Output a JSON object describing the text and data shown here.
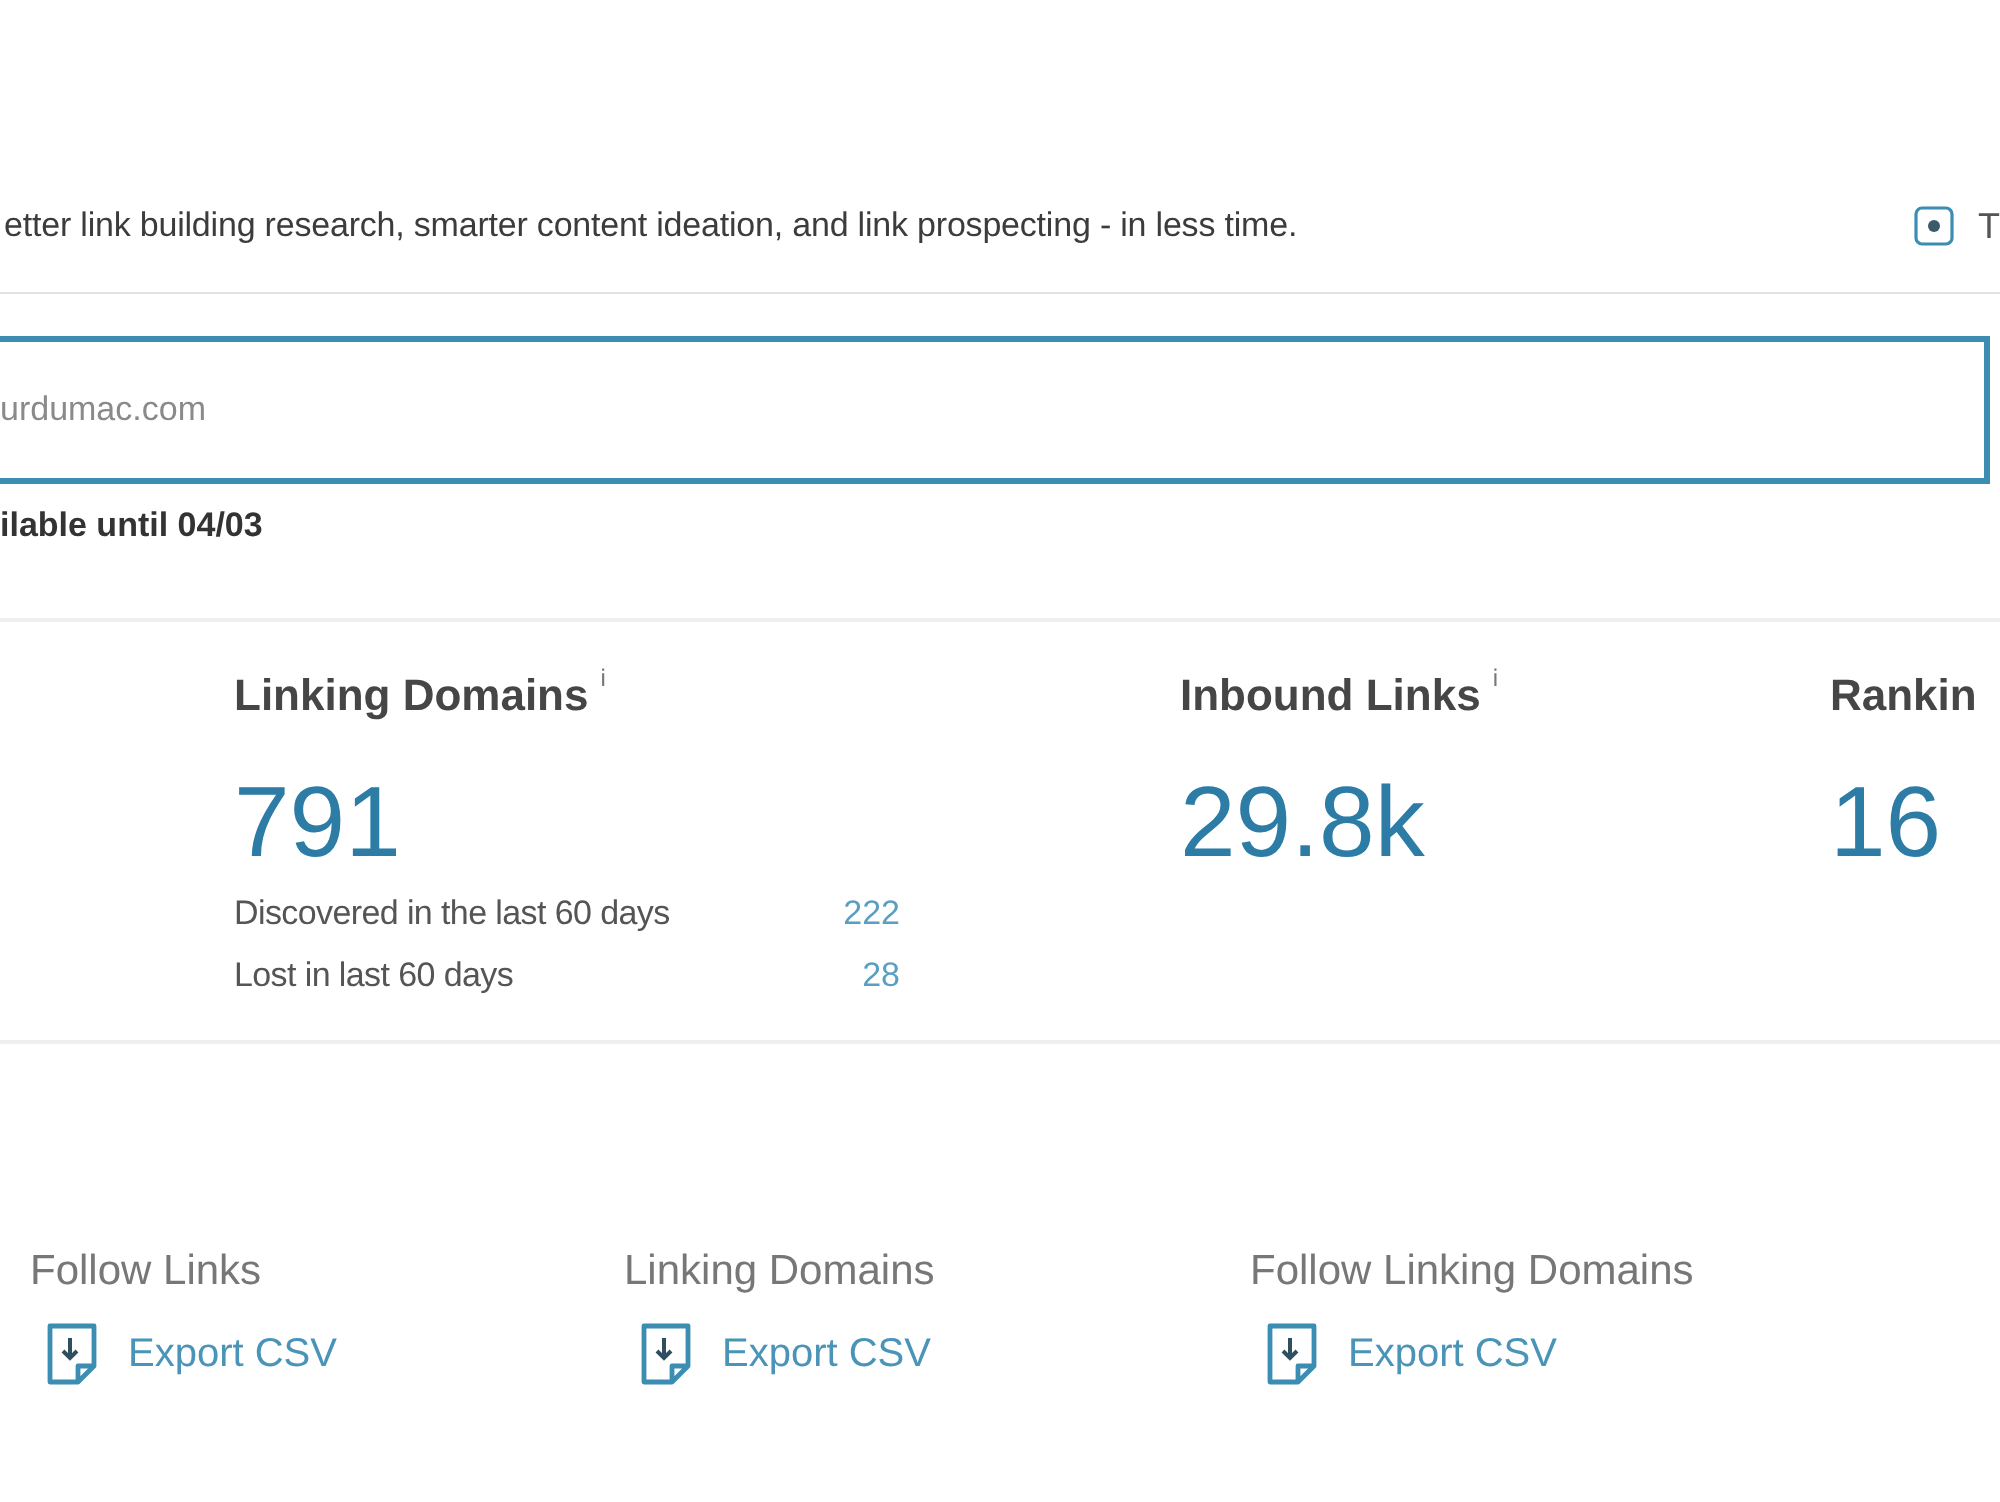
{
  "header": {
    "tagline": "etter link building research, smarter content ideation, and link prospecting - in less time.",
    "tour_button": "T"
  },
  "search": {
    "value": "urdumac.com",
    "availability": "ilable until 04/03"
  },
  "stats": [
    {
      "title": "Linking Domains",
      "info": "i",
      "value": "791",
      "details": [
        {
          "label": "Discovered in the last 60 days",
          "value": "222"
        },
        {
          "label": "Lost in last 60 days",
          "value": "28"
        }
      ]
    },
    {
      "title": "Inbound Links",
      "info": "i",
      "value": "29.8k"
    },
    {
      "title": "Rankin",
      "value": "16"
    }
  ],
  "exports": [
    {
      "title": "Follow Links",
      "action": "Export CSV"
    },
    {
      "title": "Linking Domains",
      "action": "Export CSV"
    },
    {
      "title": "Follow Linking Domains",
      "action": "Export CSV"
    }
  ]
}
